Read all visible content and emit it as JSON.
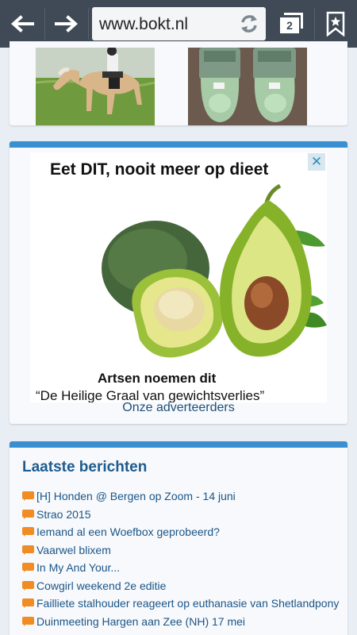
{
  "browser": {
    "url": "www.bokt.nl",
    "tab_count": "2"
  },
  "ad": {
    "headline": "Eet DIT, nooit meer op dieet",
    "caption_line1": "Artsen noemen dit",
    "caption_line2": "“De Heilige Graal van gewichtsverlies”",
    "close_symbol": "✕",
    "advertisers_link": "Onze adverteerders"
  },
  "news": {
    "title": "Laatste berichten",
    "items": [
      "[H] Honden @ Bergen op Zoom - 14 juni",
      "Strao 2015",
      "Iemand al een Woefbox geprobeerd?",
      "Vaarwel blixem",
      "In My And Your...",
      "Cowgirl weekend 2e editie",
      "Failliete stalhouder reageert op euthanasie van Shetlandpony",
      "Duinmeeting Hargen aan Zee (NH) 17 mei"
    ]
  },
  "colors": {
    "toolbar": "#3f4a56",
    "accent": "#3a8fd0",
    "link": "#1c5587",
    "bubble": "#f08c23"
  }
}
